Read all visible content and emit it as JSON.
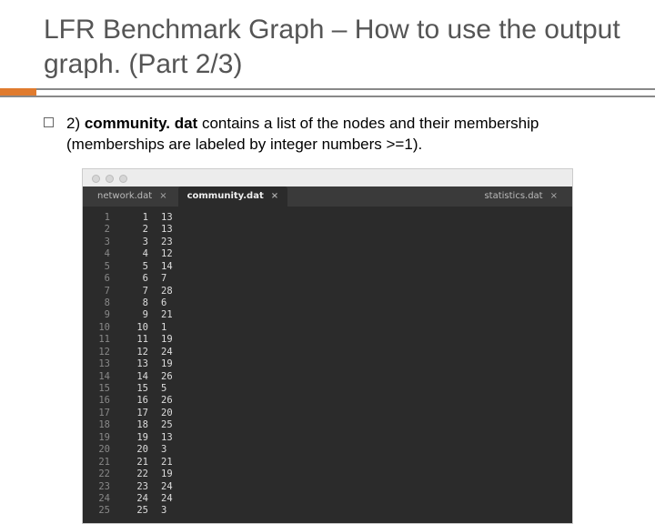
{
  "title": "LFR Benchmark Graph – How to use the output graph. (Part 2/3)",
  "bullet": {
    "prefix": "2) ",
    "bold": "community. dat",
    "rest": " contains a list of the nodes and their membership (memberships are labeled by integer numbers >=1)."
  },
  "tabs": {
    "left": "network.dat",
    "active": "community.dat",
    "right": "statistics.dat",
    "close": "×"
  },
  "rows": [
    {
      "ln": "1",
      "a": "1",
      "b": "13"
    },
    {
      "ln": "2",
      "a": "2",
      "b": "13"
    },
    {
      "ln": "3",
      "a": "3",
      "b": "23"
    },
    {
      "ln": "4",
      "a": "4",
      "b": "12"
    },
    {
      "ln": "5",
      "a": "5",
      "b": "14"
    },
    {
      "ln": "6",
      "a": "6",
      "b": "7"
    },
    {
      "ln": "7",
      "a": "7",
      "b": "28"
    },
    {
      "ln": "8",
      "a": "8",
      "b": "6"
    },
    {
      "ln": "9",
      "a": "9",
      "b": "21"
    },
    {
      "ln": "10",
      "a": "10",
      "b": "1"
    },
    {
      "ln": "11",
      "a": "11",
      "b": "19"
    },
    {
      "ln": "12",
      "a": "12",
      "b": "24"
    },
    {
      "ln": "13",
      "a": "13",
      "b": "19"
    },
    {
      "ln": "14",
      "a": "14",
      "b": "26"
    },
    {
      "ln": "15",
      "a": "15",
      "b": "5"
    },
    {
      "ln": "16",
      "a": "16",
      "b": "26"
    },
    {
      "ln": "17",
      "a": "17",
      "b": "20"
    },
    {
      "ln": "18",
      "a": "18",
      "b": "25"
    },
    {
      "ln": "19",
      "a": "19",
      "b": "13"
    },
    {
      "ln": "20",
      "a": "20",
      "b": "3"
    },
    {
      "ln": "21",
      "a": "21",
      "b": "21"
    },
    {
      "ln": "22",
      "a": "22",
      "b": "19"
    },
    {
      "ln": "23",
      "a": "23",
      "b": "24"
    },
    {
      "ln": "24",
      "a": "24",
      "b": "24"
    },
    {
      "ln": "25",
      "a": "25",
      "b": "3"
    }
  ]
}
